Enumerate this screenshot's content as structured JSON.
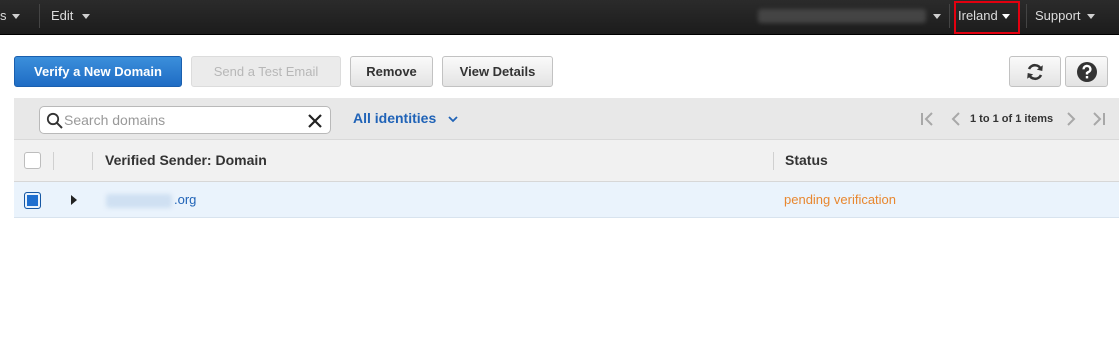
{
  "topnav": {
    "services_fragment": "s",
    "edit_label": "Edit",
    "region_label": "Ireland",
    "support_label": "Support"
  },
  "toolbar": {
    "verify_label": "Verify a New Domain",
    "test_email_label": "Send a Test Email",
    "remove_label": "Remove",
    "view_details_label": "View Details"
  },
  "filter": {
    "search_placeholder": "Search domains",
    "identities_label": "All identities",
    "pagination_text": "1 to 1 of 1 items"
  },
  "table": {
    "columns": [
      "Verified Sender: Domain",
      "Status"
    ],
    "rows": [
      {
        "domain": ".org",
        "status": "pending verification",
        "selected": true
      }
    ]
  },
  "colors": {
    "topnav_bg": "#232323",
    "primary_button": "#1f6cc4",
    "link": "#2063b7",
    "status_pending": "#e8872f",
    "region_highlight": "#e3000f"
  }
}
